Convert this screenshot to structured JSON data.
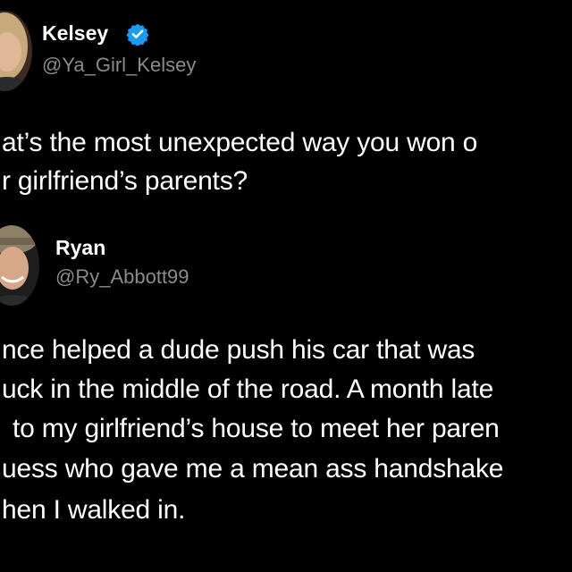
{
  "tweet": {
    "author": {
      "display_name": "Kelsey",
      "handle": "@Ya_Girl_Kelsey",
      "verified_icon": "verified-badge-icon",
      "avatar_icon": "profile-photo"
    },
    "text_lines": [
      "at’s the most unexpected way you won o",
      "r girlfriend’s parents?"
    ]
  },
  "reply": {
    "author": {
      "display_name": "Ryan",
      "handle": "@Ry_Abbott99",
      "avatar_icon": "profile-photo"
    },
    "text_lines": [
      "nce helped a dude push his car that was",
      "uck in the middle of the road. A month late",
      "to my girlfriend’s house to meet her paren",
      "uess who gave me a mean ass handshake",
      "hen I walked in."
    ]
  },
  "colors": {
    "background": "#000000",
    "text": "#ffffff",
    "handle": "#8b8b8b",
    "verified": "#1d9bf0"
  }
}
